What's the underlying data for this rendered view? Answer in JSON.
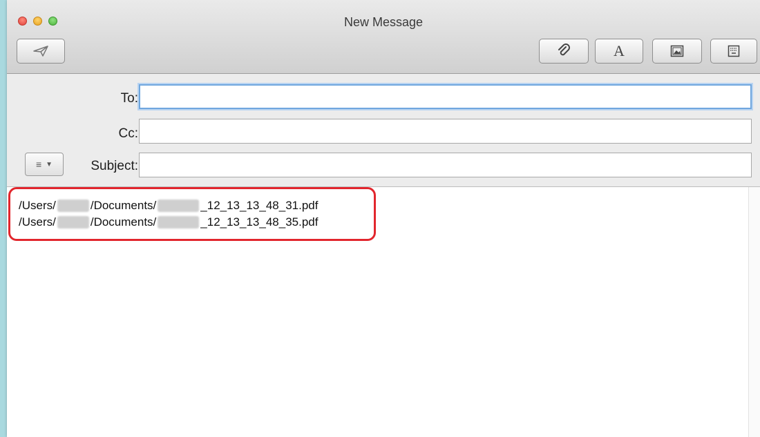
{
  "window": {
    "title": "New Message"
  },
  "toolbar": {
    "send": {
      "icon": "paper-plane-icon"
    },
    "attach": {
      "icon": "paperclip-icon"
    },
    "font": {
      "icon": "font-icon",
      "label": "A"
    },
    "photo": {
      "icon": "photo-browser-icon"
    },
    "template": {
      "icon": "stationery-icon"
    }
  },
  "headers": {
    "to": {
      "label": "To:",
      "value": ""
    },
    "cc": {
      "label": "Cc:",
      "value": ""
    },
    "subject": {
      "label": "Subject:",
      "value": ""
    },
    "format_menu": {
      "icon": "list-icon",
      "caret": "chevron-down-icon"
    }
  },
  "body": {
    "attachments": [
      {
        "prefix": "/Users/",
        "middle": "/Documents/",
        "suffix": "_12_13_13_48_31.pdf"
      },
      {
        "prefix": "/Users/",
        "middle": "/Documents/",
        "suffix": "_12_13_13_48_35.pdf"
      }
    ]
  },
  "colors": {
    "highlight": "#e2262d",
    "focus_ring": "#6fa6de",
    "background": "#a9d9df"
  }
}
